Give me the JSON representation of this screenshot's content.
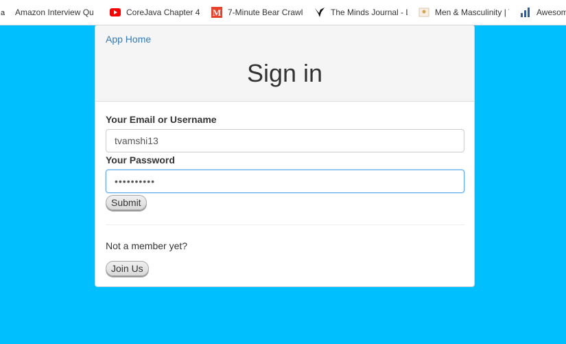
{
  "bookmarks": [
    {
      "label": "Amazon Interview Qu",
      "icon": "amazon-icon"
    },
    {
      "label": "CoreJava Chapter 4 -",
      "icon": "youtube-icon"
    },
    {
      "label": "7-Minute Bear Crawl",
      "icon": "m-logo-icon"
    },
    {
      "label": "The Minds Journal - L",
      "icon": "bird-icon"
    },
    {
      "label": "Men & Masculinity | T",
      "icon": "page-icon"
    },
    {
      "label": "Awesome Ph",
      "icon": "chart-icon"
    }
  ],
  "header": {
    "app_home": "App Home",
    "title": "Sign in"
  },
  "form": {
    "email_label": "Your Email or Username",
    "email_value": "tvamshi13",
    "password_label": "Your Password",
    "password_value": "tvamshi131",
    "submit_label": "Submit"
  },
  "signup": {
    "prompt": "Not a member yet?",
    "join_label": "Join Us"
  },
  "colors": {
    "background": "#00bfff",
    "link": "#337ab7",
    "focus_border": "#66afe9"
  }
}
